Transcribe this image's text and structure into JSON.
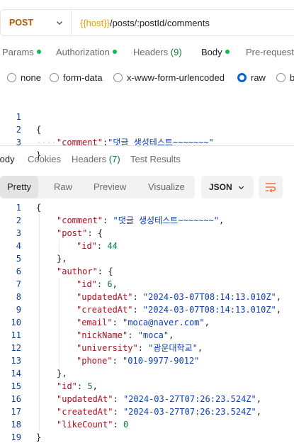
{
  "request": {
    "method": "POST",
    "url_var": "{{host}}",
    "url_path": "/posts/:postId/comments"
  },
  "req_tabs": {
    "params": "Params",
    "authorization": "Authorization",
    "headers": "Headers",
    "headers_count": "(9)",
    "body": "Body",
    "prerequest": "Pre-request"
  },
  "body_types": {
    "none": "none",
    "form_data": "form-data",
    "urlencoded": "x-www-form-urlencoded",
    "raw": "raw",
    "binary": "b"
  },
  "request_body": {
    "line_numbers": [
      "1",
      "2",
      "3"
    ],
    "open_brace": "{",
    "key": "\"comment\"",
    "colon": ":",
    "value": "\"댓글 생성테스트~~~~~~~\"",
    "close_brace": "}"
  },
  "res_tabs": {
    "body": "Body",
    "cookies": "Cookies",
    "headers": "Headers",
    "headers_count": "(7)",
    "test_results": "Test Results"
  },
  "view_modes": {
    "pretty": "Pretty",
    "raw": "Raw",
    "preview": "Preview",
    "visualize": "Visualize"
  },
  "format": "JSON",
  "response_body": {
    "line_numbers": [
      "1",
      "2",
      "3",
      "4",
      "5",
      "6",
      "7",
      "8",
      "9",
      "10",
      "11",
      "12",
      "13",
      "14",
      "15",
      "16",
      "17",
      "18",
      "19"
    ],
    "open_brace": "{",
    "comment_key": "\"comment\"",
    "comment_val": "\"댓글 생성테스트~~~~~~~\"",
    "post_key": "\"post\"",
    "post_id_key": "\"id\"",
    "post_id_val": "44",
    "author_key": "\"author\"",
    "author_id_key": "\"id\"",
    "author_id_val": "6",
    "updated_key": "\"updatedAt\"",
    "updated_val": "\"2024-03-07T08:14:13.010Z\"",
    "created_key": "\"createdAt\"",
    "created_val": "\"2024-03-07T08:14:13.010Z\"",
    "email_key": "\"email\"",
    "email_val": "\"moca@naver.com\"",
    "nick_key": "\"nickName\"",
    "nick_val": "\"moca\"",
    "univ_key": "\"university\"",
    "univ_val": "\"광운대학교\"",
    "phone_key": "\"phone\"",
    "phone_val": "\"010-9977-9012\"",
    "id_key": "\"id\"",
    "id_val": "5",
    "r_updated_key": "\"updatedAt\"",
    "r_updated_val": "\"2024-03-27T07:26:23.524Z\"",
    "r_created_key": "\"createdAt\"",
    "r_created_val": "\"2024-03-27T07:26:23.524Z\"",
    "like_key": "\"likeCount\"",
    "like_val": "0",
    "close_brace": "}"
  },
  "colors": {
    "method": "#ab5b00",
    "variable": "#e0a000",
    "accent": "#ff6c37",
    "status_dot": "#0cbb52",
    "json_key": "#a3131e",
    "json_string": "#0c3fa9",
    "json_number": "#0c7a3a"
  },
  "icons": {
    "method_dropdown": "chevron-down-icon",
    "format_dropdown": "chevron-down-icon",
    "wrap": "wrap-lines-icon"
  }
}
